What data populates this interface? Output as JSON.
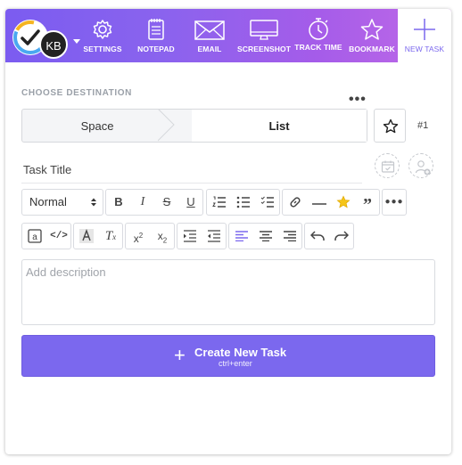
{
  "user": {
    "initials": "KB"
  },
  "nav": [
    {
      "label": "SETTINGS",
      "icon": "gear-icon"
    },
    {
      "label": "NOTEPAD",
      "icon": "notepad-icon"
    },
    {
      "label": "EMAIL",
      "icon": "envelope-icon"
    },
    {
      "label": "SCREENSHOT",
      "icon": "monitor-icon"
    },
    {
      "label": "TRACK TIME",
      "icon": "stopwatch-icon"
    },
    {
      "label": "BOOKMARK",
      "icon": "star-outline-icon"
    },
    {
      "label": "NEW TASK",
      "icon": "plus-icon",
      "active": true
    }
  ],
  "destination": {
    "label": "CHOOSE DESTINATION",
    "space": "Space",
    "list": "List",
    "hash": "#1"
  },
  "task": {
    "title_placeholder": "Task Title",
    "description_placeholder": "Add description"
  },
  "editor": {
    "text_style": "Normal"
  },
  "create_button": {
    "label": "Create New Task",
    "shortcut": "ctrl+enter"
  },
  "colors": {
    "accent": "#7b68ee",
    "star_fill": "#f5c518"
  }
}
